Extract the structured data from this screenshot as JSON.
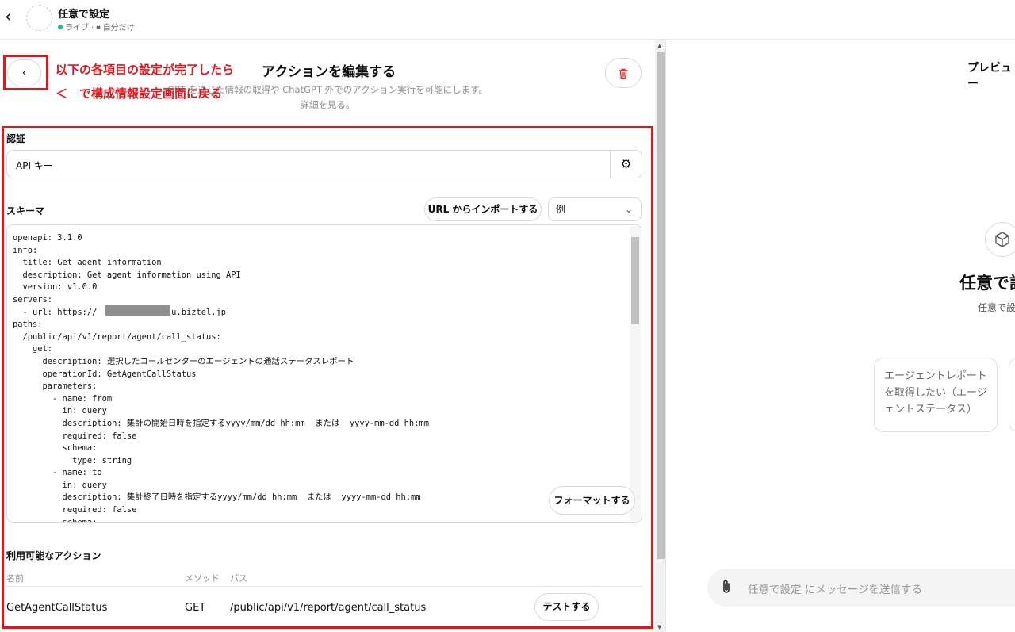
{
  "header": {
    "gpt_name": "任意で設定",
    "status": "ライブ · ",
    "visibility": "自分だけ"
  },
  "editor": {
    "title": "アクションを編集する",
    "description_line1": "GPT を通じた情報の取得や ChatGPT 外でのアクション実行を可能にします。",
    "description_line2": "詳細を見る。",
    "back_symbol": "‹",
    "annotation_line1": "以下の各項目の設定が完了したら",
    "annotation_line2": "＜　で構成情報設定画面に戻る"
  },
  "auth": {
    "label": "認証",
    "value": "API キー"
  },
  "schema": {
    "label": "スキーマ",
    "import_button": "URL からインポートする",
    "example_select": "例",
    "format_button": "フォーマットする",
    "code": "openapi: 3.1.0\ninfo:\n  title: Get agent information\n  description: Get agent information using API\n  version: v1.0.0\nservers:\n  - url: https://              .u.biztel.jp\npaths:\n  /public/api/v1/report/agent/call_status:\n    get:\n      description: 選択したコールセンターのエージェントの通話ステータスレポート\n      operationId: GetAgentCallStatus\n      parameters:\n        - name: from\n          in: query\n          description: 集計の開始日時を指定するyyyy/mm/dd hh:mm  または  yyyy-mm-dd hh:mm\n          required: false\n          schema:\n            type: string\n        - name: to\n          in: query\n          description: 集計終了日時を指定するyyyy/mm/dd hh:mm  または  yyyy-mm-dd hh:mm\n          required: false\n          schema:"
  },
  "actions": {
    "label": "利用可能なアクション",
    "columns": [
      "名前",
      "メソッド",
      "パス"
    ],
    "rows": [
      {
        "name": "GetAgentCallStatus",
        "method": "GET",
        "path": "/public/api/v1/report/agent/call_status",
        "test": "テストする"
      }
    ]
  },
  "preview": {
    "label": "プレビュー",
    "name": "任意で設定",
    "description": "任意で設定",
    "starter": "エージェントレポートを取得したい（エージェントステータス）",
    "composer_placeholder": "任意で設定 にメッセージを送信する"
  },
  "colors": {
    "annotation_red": "#e4141b",
    "live_green": "#19c37d",
    "delete_red": "#e02e2a"
  }
}
